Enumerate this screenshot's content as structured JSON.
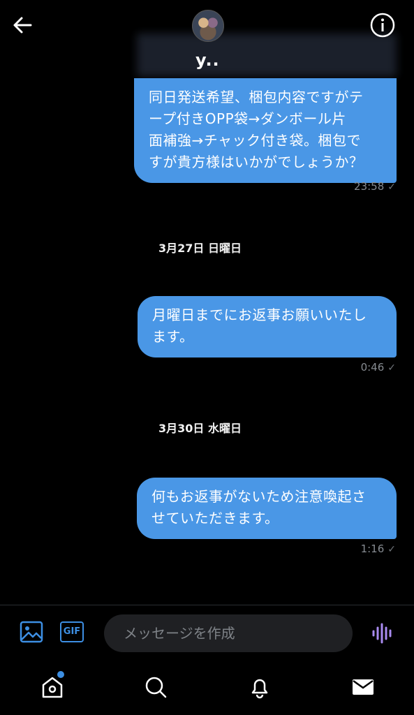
{
  "header": {
    "contact_name": "y..",
    "back_icon": "arrow-left-icon",
    "info_icon": "info-icon"
  },
  "messages": [
    {
      "text_lines": [
        "同日発送希望、梱包内容ですがテ",
        "ープ付きOPP袋→ダンボール片",
        "面補強→チャック付き袋。梱包で",
        "すが貴方様はいかがでしょうか？"
      ],
      "time": "23:58"
    },
    {
      "text_lines": [
        "月曜日までにお返事お願いいたし",
        "ます。"
      ],
      "time": "0:46"
    },
    {
      "text_lines": [
        "何もお返事がないため注意喚起さ",
        "せていただきます。"
      ],
      "time": "1:16"
    }
  ],
  "date_separators": [
    "3月27日 日曜日",
    "3月30日 水曜日"
  ],
  "read_mark": "✓",
  "composer": {
    "placeholder": "メッセージを作成",
    "gif_label": "GIF",
    "image_icon": "image-icon",
    "voice_icon": "voice-wave-icon"
  },
  "nav": {
    "items": [
      "home-icon",
      "search-icon",
      "bell-icon",
      "mail-icon"
    ]
  },
  "colors": {
    "bubble": "#4a97e6",
    "accent": "#3d8fe3",
    "voice": "#a98bf0"
  }
}
